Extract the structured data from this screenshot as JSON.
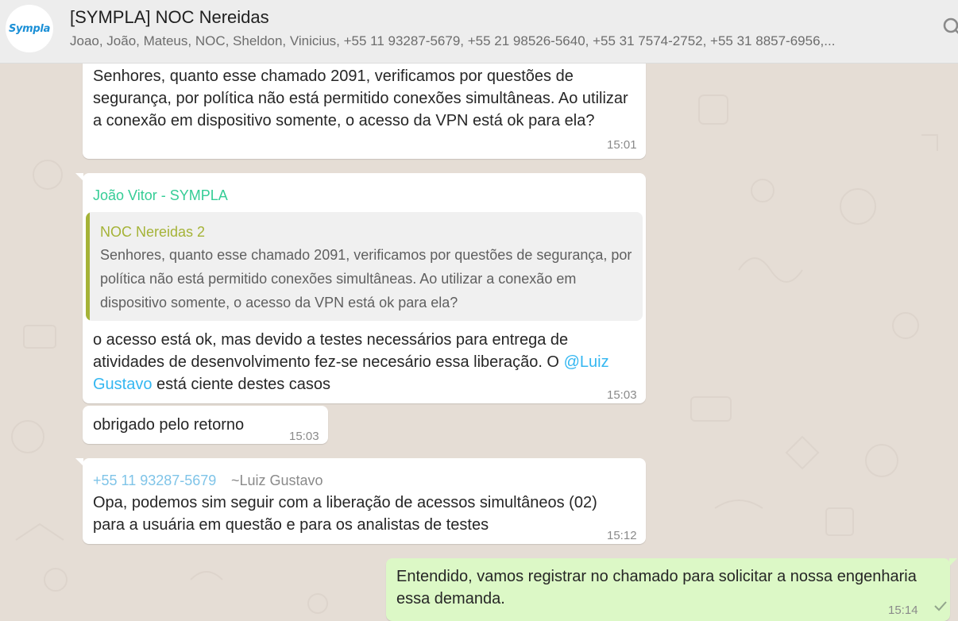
{
  "header": {
    "avatar_text": "Sympla",
    "title": "[SYMPLA] NOC Nereidas",
    "members": "Joao, João, Mateus, NOC, Sheldon, Vinicius, +55 11 93287-5679, +55 21 98526-5640, +55 31 7574-2752, +55 31 8857-6956,..."
  },
  "messages": {
    "m1": {
      "text": "Senhores, quanto esse chamado 2091, verificamos por questões de segurança, por política não está permitido conexões simultâneas. Ao utilizar a conexão em dispositivo somente, o acesso da VPN está ok para ela?",
      "time": "15:01"
    },
    "m2": {
      "sender": "João Vitor - SYMPLA",
      "quote_author": "NOC Nereidas 2",
      "quote_text": "Senhores, quanto esse chamado 2091, verificamos por questões de segurança, por política não está permitido conexões simultâneas. Ao utilizar a conexão em dispositivo somente, o acesso da VPN está ok para ela?",
      "text_before": "o acesso está ok, mas devido a testes necessários para entrega de atividades de desenvolvimento fez-se necesário essa liberação. O ",
      "mention_at": "@",
      "mention": "Luiz Gustavo",
      "text_after": " está ciente destes casos",
      "time": "15:03"
    },
    "m3": {
      "text": "obrigado pelo retorno",
      "time": "15:03"
    },
    "m4": {
      "phone": "+55 11 93287-5679",
      "pushname": "~Luiz Gustavo",
      "text": "Opa, podemos sim seguir com a liberação de acessos simultâneos (02) para a usuária em questão e para os analistas de testes",
      "time": "15:12"
    },
    "m5": {
      "text": "Entendido, vamos registrar no chamado para solicitar a nossa engenharia essa demanda.",
      "time": "15:14",
      "status_icon": "single-check-icon"
    }
  },
  "colors": {
    "background": "#e5ddd5",
    "incoming_bubble": "#ffffff",
    "outgoing_bubble": "#dcf8c6",
    "sender_name": "#35cd96",
    "quote_author": "#a5b337",
    "mention": "#34b7f1"
  }
}
